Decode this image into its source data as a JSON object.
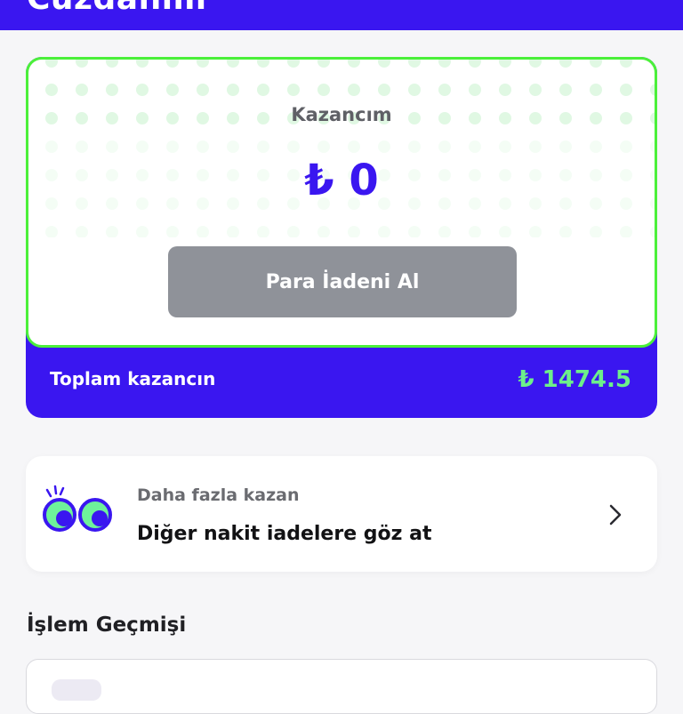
{
  "header": {
    "title": "Cüzdanım"
  },
  "earnings": {
    "label": "Kazancım",
    "amount": "₺ 0",
    "button_label": "Para İadeni Al",
    "total_label": "Toplam kazancın",
    "total_value": "₺ 1474.5"
  },
  "more": {
    "subtitle": "Daha fazla kazan",
    "title": "Diğer nakit iadelere göz at",
    "icon": "eyes-icon",
    "chevron_icon": "chevron-right-icon"
  },
  "history": {
    "title": "İşlem Geçmişi"
  },
  "colors": {
    "brand": "#3a16f0",
    "accent_green": "#4bf03a",
    "total_value": "#6df08a",
    "button_disabled": "#8f9299"
  }
}
